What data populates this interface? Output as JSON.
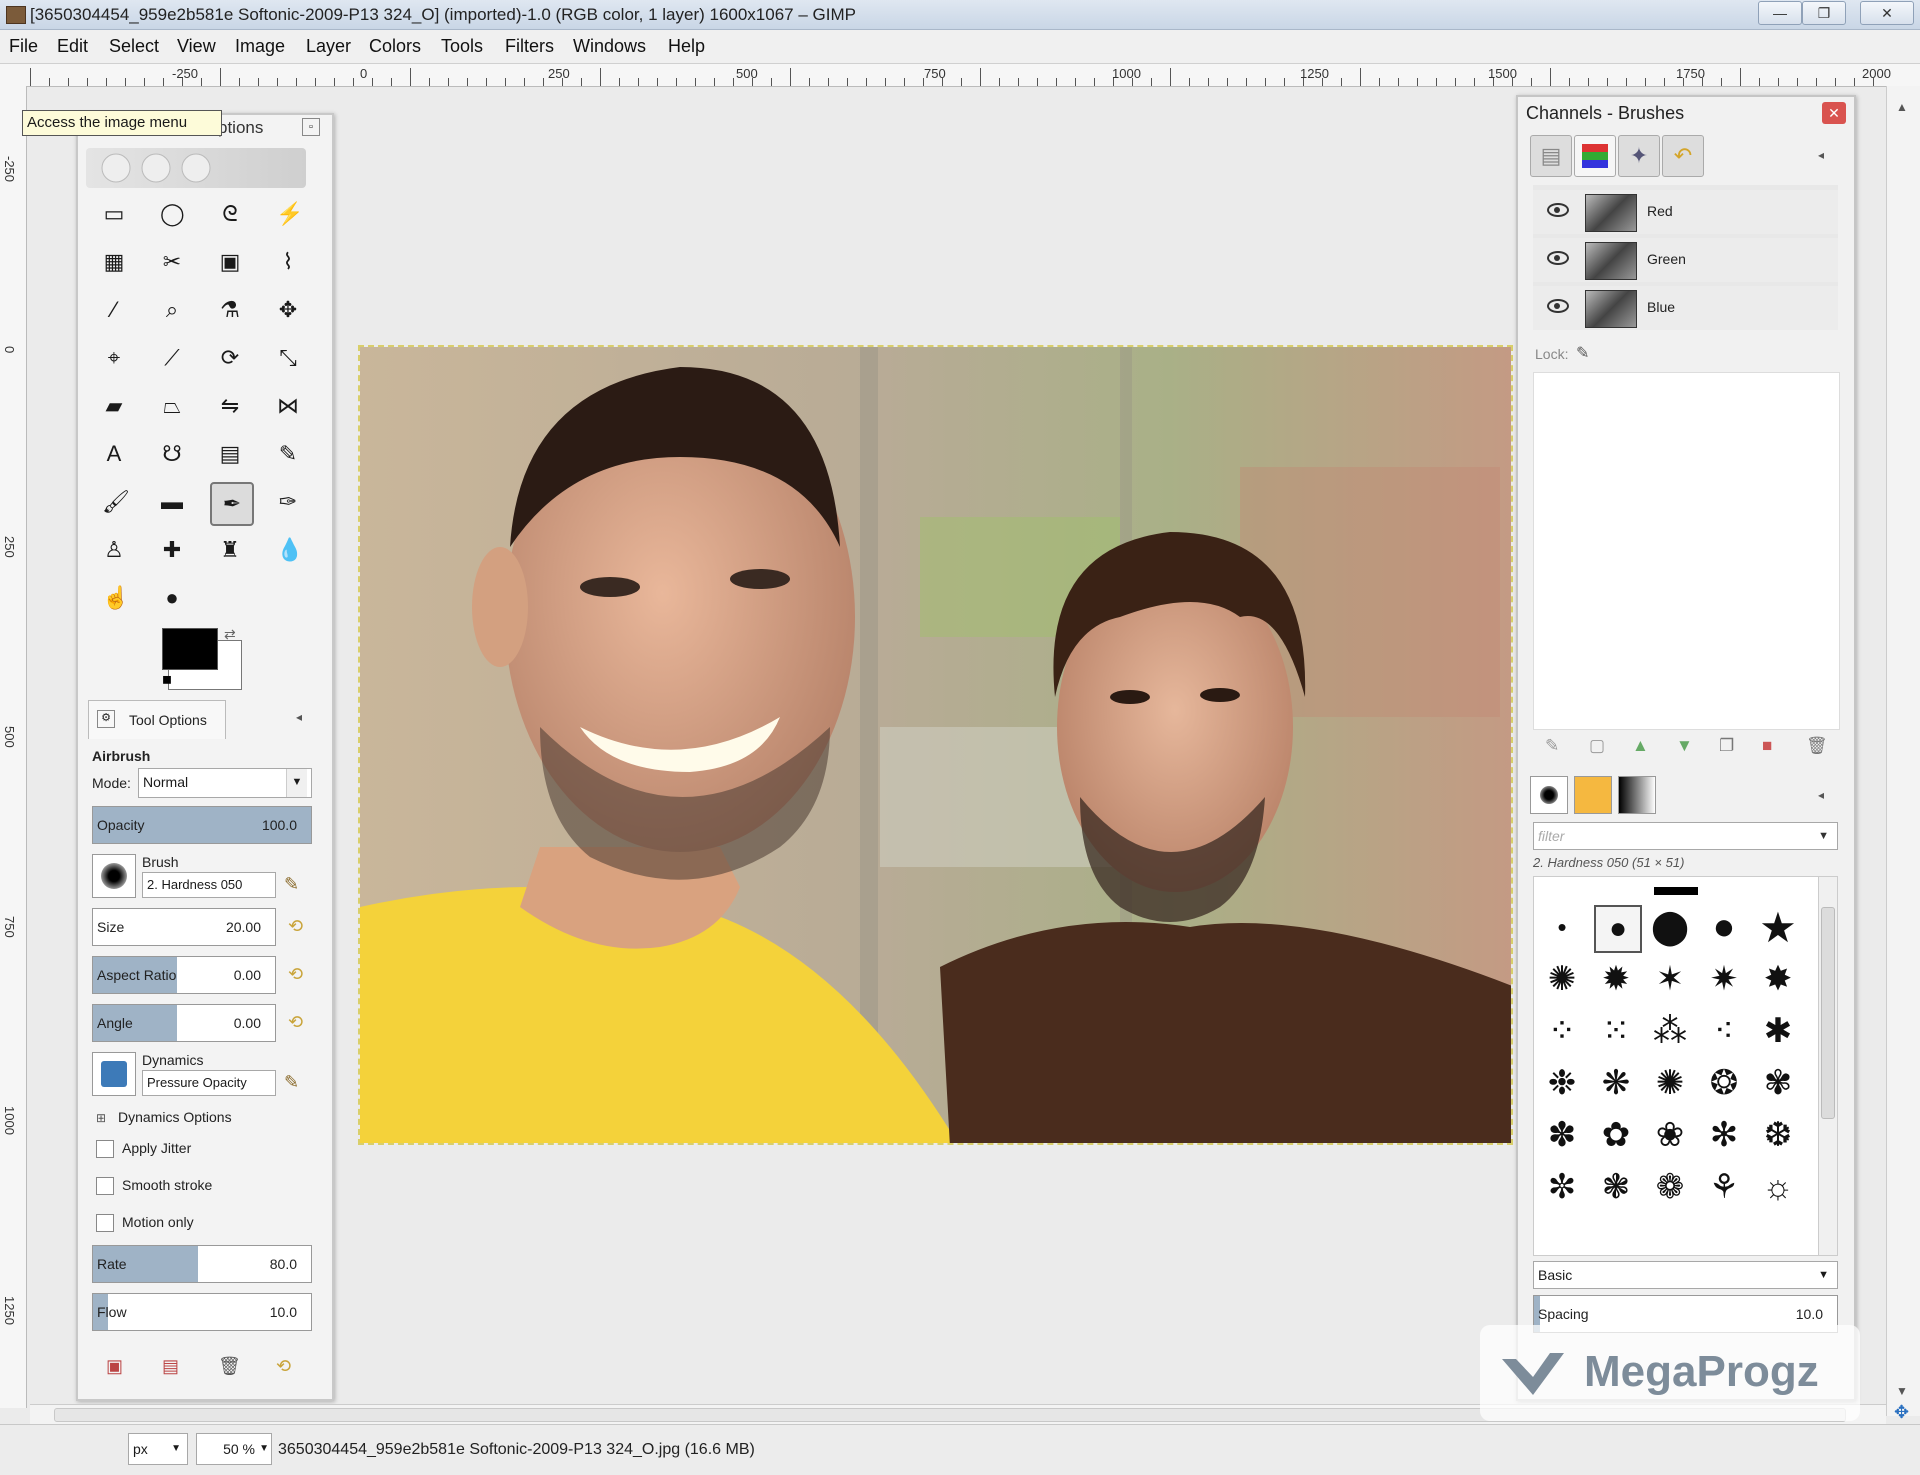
{
  "window": {
    "title": "[3650304454_959e2b581e Softonic-2009-P13 324_O] (imported)-1.0 (RGB color, 1 layer) 1600x1067 – GIMP",
    "controls": [
      "—",
      "❐",
      "✕"
    ]
  },
  "menubar": [
    "File",
    "Edit",
    "Select",
    "View",
    "Image",
    "Layer",
    "Colors",
    "Tools",
    "Filters",
    "Windows",
    "Help"
  ],
  "ruler": {
    "h_labels": [
      "-250",
      "0",
      "250",
      "500",
      "750",
      "1000",
      "1250",
      "1500",
      "1750",
      "2000"
    ],
    "v_labels": [
      "-250",
      "0",
      "250",
      "500",
      "750",
      "1000",
      "1250"
    ]
  },
  "tooltip": "Access the image menu",
  "toolbox": {
    "title": "ptions",
    "tools": [
      {
        "name": "rect-select-icon",
        "glyph": "▭"
      },
      {
        "name": "ellipse-select-icon",
        "glyph": "◯"
      },
      {
        "name": "free-select-icon",
        "glyph": "ᘓ"
      },
      {
        "name": "fuzzy-select-icon",
        "glyph": "⚡"
      },
      {
        "name": "select-by-color-icon",
        "glyph": "▦"
      },
      {
        "name": "scissors-select-icon",
        "glyph": "✂"
      },
      {
        "name": "foreground-select-icon",
        "glyph": "▣"
      },
      {
        "name": "paths-icon",
        "glyph": "⌇"
      },
      {
        "name": "color-picker-icon",
        "glyph": "⁄"
      },
      {
        "name": "zoom-icon",
        "glyph": "⌕"
      },
      {
        "name": "measure-icon",
        "glyph": "⚗"
      },
      {
        "name": "move-icon",
        "glyph": "✥"
      },
      {
        "name": "align-icon",
        "glyph": "⌖"
      },
      {
        "name": "crop-icon",
        "glyph": "⟋"
      },
      {
        "name": "rotate-icon",
        "glyph": "⟳"
      },
      {
        "name": "scale-icon",
        "glyph": "⤡"
      },
      {
        "name": "shear-icon",
        "glyph": "▰"
      },
      {
        "name": "perspective-icon",
        "glyph": "⏢"
      },
      {
        "name": "flip-icon",
        "glyph": "⇋"
      },
      {
        "name": "cage-icon",
        "glyph": "⋈"
      },
      {
        "name": "text-icon",
        "glyph": "A"
      },
      {
        "name": "bucket-fill-icon",
        "glyph": "☋"
      },
      {
        "name": "blend-icon",
        "glyph": "▤"
      },
      {
        "name": "pencil-icon",
        "glyph": "✎"
      },
      {
        "name": "paintbrush-icon",
        "glyph": "🖌"
      },
      {
        "name": "eraser-icon",
        "glyph": "▬"
      },
      {
        "name": "airbrush-icon",
        "glyph": "✒"
      },
      {
        "name": "ink-icon",
        "glyph": "✑"
      },
      {
        "name": "clone-icon",
        "glyph": "♙"
      },
      {
        "name": "heal-icon",
        "glyph": "✚"
      },
      {
        "name": "perspective-clone-icon",
        "glyph": "♜"
      },
      {
        "name": "blur-icon",
        "glyph": "💧"
      },
      {
        "name": "smudge-icon",
        "glyph": "☝"
      },
      {
        "name": "dodge-burn-icon",
        "glyph": "●"
      }
    ],
    "tab_label": "Tool Options",
    "tool_name": "Airbrush",
    "mode_label": "Mode:",
    "mode_value": "Normal",
    "opacity": {
      "label": "Opacity",
      "value": "100.0",
      "fraction": 1.0
    },
    "brush_label": "Brush",
    "brush_value": "2. Hardness 050",
    "size": {
      "label": "Size",
      "value": "20.00",
      "fraction": 0.0
    },
    "aspect": {
      "label": "Aspect Ratio",
      "value": "0.00",
      "fraction": 0.46
    },
    "angle": {
      "label": "Angle",
      "value": "0.00",
      "fraction": 0.46
    },
    "dynamics_label": "Dynamics",
    "dynamics_value": "Pressure Opacity",
    "dynamics_options": "Dynamics Options",
    "apply_jitter": "Apply Jitter",
    "smooth_stroke": "Smooth stroke",
    "motion_only": "Motion only",
    "rate": {
      "label": "Rate",
      "value": "80.0",
      "fraction": 0.48
    },
    "flow": {
      "label": "Flow",
      "value": "10.0",
      "fraction": 0.07
    }
  },
  "dock": {
    "title": "Channels - Brushes",
    "channels": [
      "Red",
      "Green",
      "Blue"
    ],
    "lock_label": "Lock:",
    "filter_placeholder": "filter",
    "brush_info": "2. Hardness 050 (51 × 51)",
    "preset": "Basic",
    "spacing": {
      "label": "Spacing",
      "value": "10.0",
      "fraction": 0.02
    }
  },
  "statusbar": {
    "unit": "px",
    "zoom": "50 %",
    "filename": "3650304454_959e2b581e Softonic-2009-P13 324_O.jpg (16.6 MB)"
  },
  "watermark": "MegaProgz",
  "colors": {
    "fg": "#000000",
    "bg": "#ffffff",
    "slider_fill": "#9fb3c6",
    "shirt_yellow": "#f6d23a",
    "shirt_brown": "#4a2c1d"
  }
}
